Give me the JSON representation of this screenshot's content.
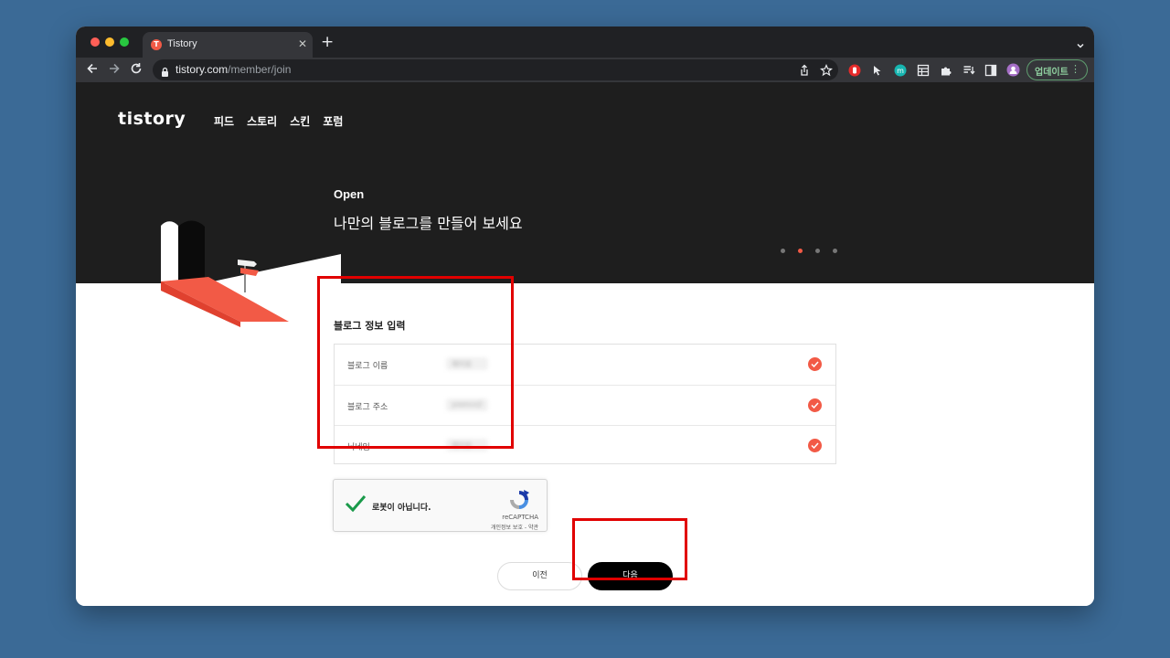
{
  "browser": {
    "tab_title": "Tistory",
    "tab_favicon": "T",
    "url_host": "tistory.com",
    "url_path": "/member/join",
    "profile_button_label": "업데이트"
  },
  "site": {
    "logo": "tistory",
    "nav": [
      "피드",
      "스토리",
      "스킨",
      "포럼"
    ]
  },
  "hero": {
    "title": "Open",
    "subtitle": "나만의 블로그를 만들어 보세요",
    "steps_total": 4,
    "step_active": 2
  },
  "form": {
    "section_title": "블로그 정보 입력",
    "rows": [
      {
        "label": "블로그 이름",
        "value": "제이호"
      },
      {
        "label": "블로그 주소",
        "value": "yoonco2"
      },
      {
        "label": "닉네임",
        "value": "제이호"
      }
    ]
  },
  "captcha": {
    "label": "로봇이 아닙니다.",
    "brand": "reCAPTCHA",
    "links": "개인정보 보호 - 약관"
  },
  "buttons": {
    "prev": "이전",
    "next": "다음"
  },
  "colors": {
    "accent": "#f25a46",
    "highlight": "#e10000",
    "header_bg": "#1e1e1e"
  }
}
